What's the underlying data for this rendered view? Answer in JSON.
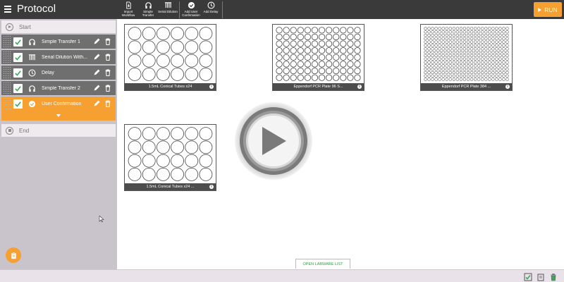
{
  "app": {
    "title": "Protocol",
    "run_label": "RUN"
  },
  "toolbar": {
    "tools": [
      {
        "label": "Import Workflow",
        "icon": "import-icon"
      },
      {
        "label": "Simple Transfer",
        "icon": "headphones-icon"
      },
      {
        "label": "Serial Dilution",
        "icon": "serial-dilution-icon"
      },
      {
        "label": "Add User Confirmation",
        "icon": "confirmation-icon"
      },
      {
        "label": "Add Delay",
        "icon": "clock-icon"
      }
    ]
  },
  "sidebar": {
    "start_label": "Start",
    "end_label": "End",
    "steps": [
      {
        "label": "Simple Transfer 1",
        "icon": "headphones-icon",
        "checked": true,
        "active": false
      },
      {
        "label": "Serial Dilution With...",
        "icon": "serial-dilution-icon",
        "checked": true,
        "active": false
      },
      {
        "label": "Delay",
        "icon": "clock-icon",
        "checked": true,
        "active": false
      },
      {
        "label": "Simple Transfer 2",
        "icon": "headphones-icon",
        "checked": true,
        "active": false
      },
      {
        "label": "User Confirmation",
        "icon": "confirmation-icon",
        "checked": true,
        "active": true
      }
    ]
  },
  "labware": [
    {
      "caption": "1.5mL Conical Tubes x24",
      "rows": 4,
      "cols": 6
    },
    {
      "caption": "Eppendorf PCR Plate 96 S...",
      "rows": 8,
      "cols": 12
    },
    {
      "caption": "Eppendorf PCR Plate 384 ...",
      "rows": 16,
      "cols": 24
    },
    {
      "caption": "1.5mL Conical Tubes x24 ...",
      "rows": 4,
      "cols": 6
    }
  ],
  "open_labware_label": "OPEN LABWARE LIST",
  "colors": {
    "accent": "#f6a032",
    "topbar": "#3a3a3a",
    "step": "#6f6f6f",
    "check": "#3aaa5a"
  }
}
